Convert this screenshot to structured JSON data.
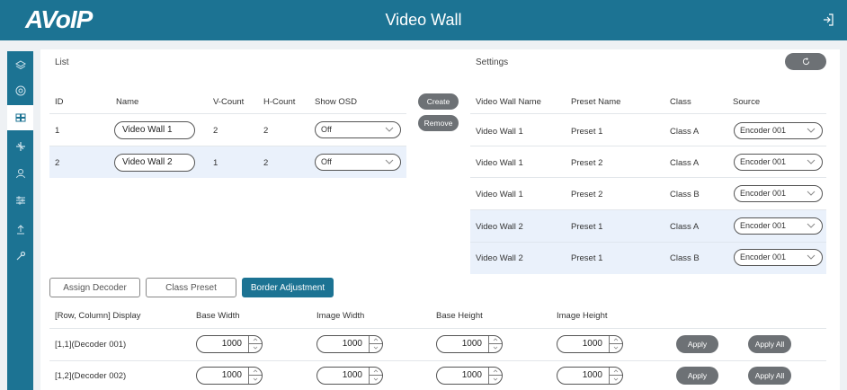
{
  "header": {
    "logo": "AVoIP",
    "title": "Video Wall"
  },
  "sidebar": {
    "items": [
      {
        "icon": "layers-icon",
        "active": false
      },
      {
        "icon": "target-icon",
        "active": false
      },
      {
        "icon": "grid-icon",
        "active": true
      },
      {
        "icon": "network-icon",
        "active": false
      },
      {
        "icon": "user-icon",
        "active": false
      },
      {
        "icon": "sliders-icon",
        "active": false
      },
      {
        "icon": "upload-icon",
        "active": false
      },
      {
        "icon": "wrench-icon",
        "active": false
      }
    ]
  },
  "list": {
    "label": "List",
    "columns": [
      "ID",
      "Name",
      "V-Count",
      "H-Count",
      "Show OSD"
    ],
    "rows": [
      {
        "id": "1",
        "name": "Video Wall 1",
        "vcount": "2",
        "hcount": "2",
        "osd": "Off"
      },
      {
        "id": "2",
        "name": "Video Wall 2",
        "vcount": "1",
        "hcount": "2",
        "osd": "Off"
      }
    ],
    "create_label": "Create",
    "remove_label": "Remove"
  },
  "settings": {
    "label": "Settings",
    "refresh_icon": "refresh-icon",
    "columns": [
      "Video Wall Name",
      "Preset Name",
      "Class",
      "Source"
    ],
    "rows": [
      {
        "wall": "Video Wall 1",
        "preset": "Preset 1",
        "cls": "Class A",
        "source": "Encoder 001"
      },
      {
        "wall": "Video Wall 1",
        "preset": "Preset 2",
        "cls": "Class A",
        "source": "Encoder 001"
      },
      {
        "wall": "Video Wall 1",
        "preset": "Preset 2",
        "cls": "Class B",
        "source": "Encoder 001"
      },
      {
        "wall": "Video Wall 2",
        "preset": "Preset 1",
        "cls": "Class A",
        "source": "Encoder 001"
      },
      {
        "wall": "Video Wall 2",
        "preset": "Preset 1",
        "cls": "Class B",
        "source": "Encoder 001"
      }
    ]
  },
  "tabs": [
    {
      "label": "Assign Decoder",
      "active": false
    },
    {
      "label": "Class Preset",
      "active": false
    },
    {
      "label": "Border Adjustment",
      "active": true
    }
  ],
  "border": {
    "columns": [
      "[Row, Column] Display",
      "Base Width",
      "Image Width",
      "Base Height",
      "Image Height"
    ],
    "rows": [
      {
        "display": "[1,1](Decoder 001)",
        "base_width": "1000",
        "image_width": "1000",
        "base_height": "1000",
        "image_height": "1000"
      },
      {
        "display": "[1,2](Decoder 002)",
        "base_width": "1000",
        "image_width": "1000",
        "base_height": "1000",
        "image_height": "1000"
      }
    ],
    "apply_label": "Apply",
    "apply_all_label": "Apply All"
  },
  "colors": {
    "brand": "#1c7393",
    "highlight_row": "#eaf1fb",
    "button_gray": "#6d7175"
  }
}
